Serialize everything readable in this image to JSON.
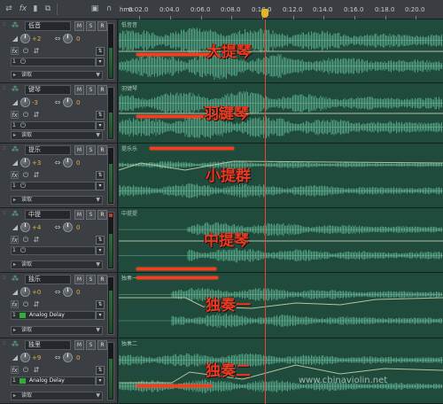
{
  "toolbar": {
    "icons": [
      "loop-icon",
      "fx-icon",
      "meter-icon",
      "level-icon",
      "monitor-icon",
      "headphones-icon"
    ],
    "ruler_unit": "hms",
    "ruler_ticks": [
      "0:02.0",
      "0:04.0",
      "0:06.0",
      "0:08.0",
      "0:10.0",
      "0:12.0",
      "0:14.0",
      "0:16.0",
      "0:18.0",
      "0:20.0"
    ]
  },
  "colors": {
    "lane": "#1f4a3c",
    "waveform": "#4f9c7e",
    "annotation": "#ea3b22",
    "playhead": "#e3b628"
  },
  "tracks": [
    {
      "name": "低音",
      "clip_name": "低音音",
      "volume": "+2",
      "pan": "0",
      "read_mode": "读取",
      "input_num": "1",
      "effect": "",
      "annotation": "大提琴",
      "amplitude": 1.0
    },
    {
      "name": "键琴",
      "clip_name": "羽键琴",
      "volume": "-3",
      "pan": "0",
      "read_mode": "读取",
      "input_num": "1",
      "effect": "",
      "annotation": "羽键琴",
      "amplitude": 0.95
    },
    {
      "name": "提乐",
      "clip_name": "提乐乐",
      "volume": "+3",
      "pan": "0",
      "read_mode": "读取",
      "input_num": "1",
      "effect": "",
      "annotation": "小提群",
      "amplitude": 0.6
    },
    {
      "name": "中提",
      "clip_name": "中提提",
      "volume": "+4",
      "pan": "0",
      "read_mode": "读取",
      "input_num": "1",
      "effect": "",
      "annotation": "中提琴",
      "amplitude": 0.55
    },
    {
      "name": "独乐",
      "clip_name": "独奏一",
      "volume": "+0",
      "pan": "0",
      "read_mode": "读取",
      "input_num": "1",
      "effect": "Analog Delay",
      "annotation": "独奏一",
      "amplitude": 0.5
    },
    {
      "name": "独里",
      "clip_name": "独奏二",
      "volume": "+9",
      "pan": "0",
      "read_mode": "读取",
      "input_num": "1",
      "effect": "Analog Delay",
      "annotation": "独奏二",
      "amplitude": 0.5
    }
  ],
  "watermark": "www.chinaviolin.net"
}
